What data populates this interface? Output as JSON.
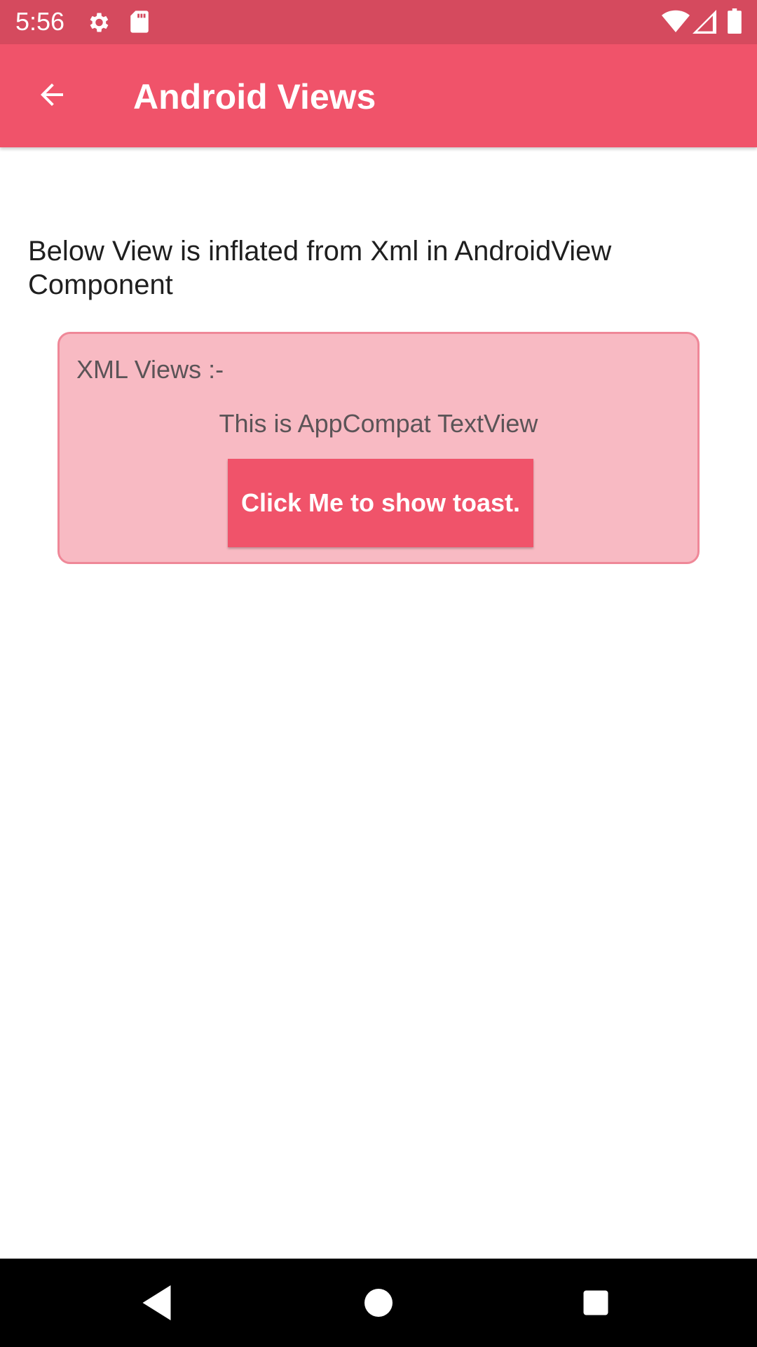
{
  "status_bar": {
    "time": "5:56",
    "icons": [
      "settings-icon",
      "sd-card-icon",
      "wifi-icon",
      "cell-signal-icon",
      "battery-icon"
    ]
  },
  "app_bar": {
    "title": "Android Views",
    "back_icon": "arrow-back-icon",
    "background_color": "#f0536a"
  },
  "content": {
    "description": "Below View is inflated from Xml in AndroidView Component",
    "card": {
      "title": "XML Views :-",
      "textview": "This is AppCompat TextView",
      "button_label": "Click Me to show toast.",
      "background_color": "#f8bac3",
      "border_color": "#ef8898"
    }
  },
  "nav_bar": {
    "icons": [
      "back-triangle-icon",
      "home-circle-icon",
      "recents-square-icon"
    ]
  }
}
